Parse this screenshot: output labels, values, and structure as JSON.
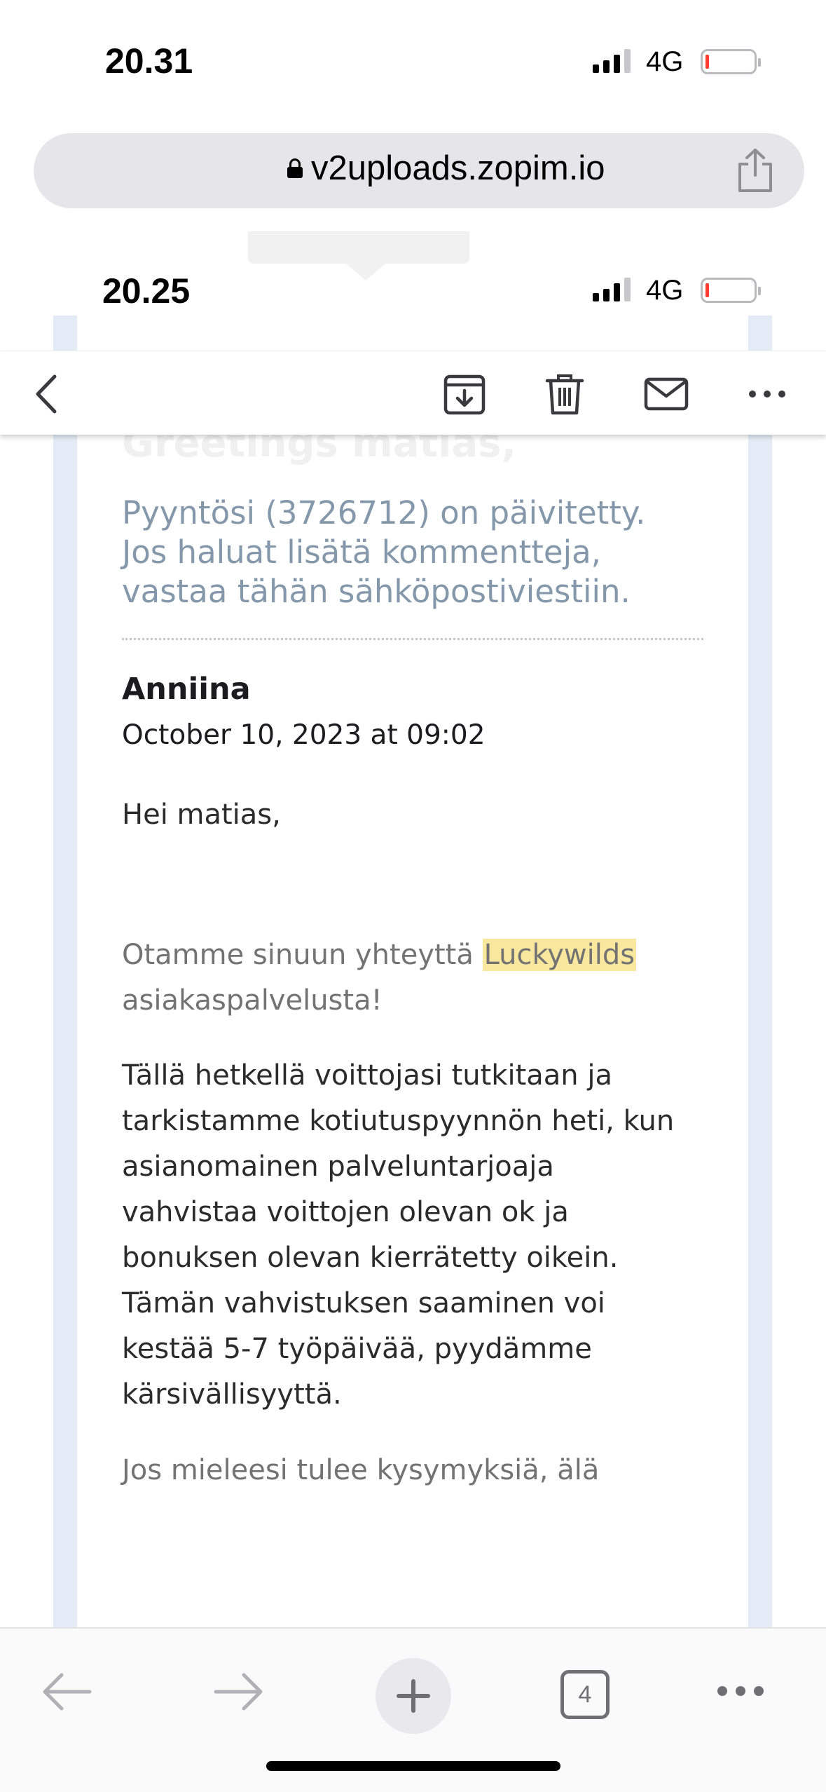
{
  "status_bar": {
    "time": "20.31",
    "network": "4G"
  },
  "browser": {
    "url": "v2uploads.zopim.io"
  },
  "inner_screenshot": {
    "status_bar": {
      "time": "20.25",
      "network": "4G"
    },
    "mail_toolbar": {
      "icons": [
        "back-icon",
        "archive-icon",
        "trash-icon",
        "mail-icon",
        "more-icon"
      ]
    },
    "email": {
      "greeting_faded": "Greetings matias,",
      "intro_lines": [
        "Pyyntösi (3726712) on päivitetty.",
        "Jos haluat lisätä kommentteja,",
        "vastaa tähän sähköpostiviestiin."
      ],
      "author": "Anniina",
      "date": "October 10, 2023 at 09:02",
      "greeting": "Hei matias,",
      "p1_before": "Otamme sinuun yhteyttä ",
      "p1_highlight": "Luckywilds",
      "p1_after": "asiakaspalvelusta!",
      "p2_lines": [
        "Tällä hetkellä voittojasi tutkitaan ja",
        "tarkistamme kotiutuspyynnön heti, kun",
        "asianomainen palveluntarjoaja",
        "vahvistaa voittojen olevan ok ja",
        "bonuksen olevan kierrätetty oikein."
      ],
      "p3_lines": [
        "Tämän vahvistuksen saaminen voi",
        "kestää 5-7 työpäivää, pyydämme",
        "kärsivällisyyttä."
      ],
      "p4_line": "Jos mieleesi tulee kysymyksiä, älä"
    }
  },
  "bottom_bar": {
    "tab_count": "4"
  },
  "colors": {
    "intro_text": "#8497ab",
    "highlight": "#f8e79c",
    "frame": "#e3ecf6",
    "battery_low": "#ff3b30"
  }
}
